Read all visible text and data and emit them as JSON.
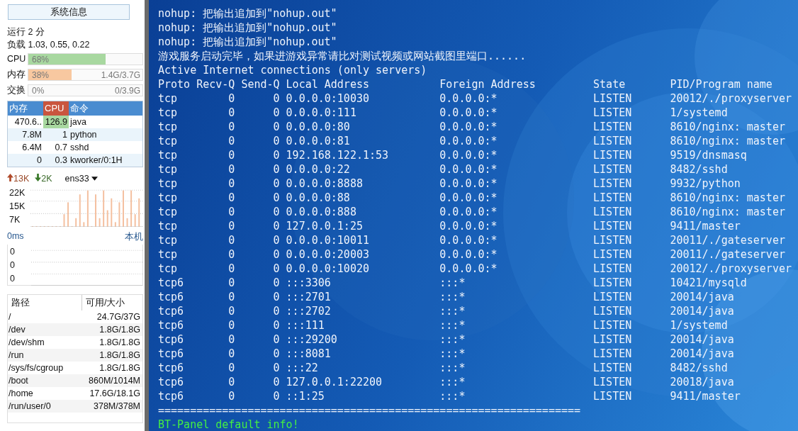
{
  "sidebar": {
    "title_button": "系统信息",
    "uptime": "运行 2 分",
    "load": "负载 1.03, 0.55, 0.22",
    "meters": [
      {
        "label": "CPU",
        "color": "#a8d8a0",
        "level": 0.68,
        "percent": "68%"
      },
      {
        "label": "内存",
        "color": "#f8c8a0",
        "level": 0.38,
        "percent": "38%",
        "amount": "1.4G/3.7G"
      },
      {
        "label": "交换",
        "percent": "0%",
        "amount": "0/3.9G"
      }
    ],
    "process_table": {
      "columns": [
        "内存",
        "CPU",
        "命令"
      ],
      "rows": [
        {
          "mem": "470.6..",
          "cpu": "126.9",
          "command": "java",
          "level": 1
        },
        {
          "mem": "7.8M",
          "cpu": "1",
          "command": "python"
        },
        {
          "mem": "6.4M",
          "cpu": "0.7",
          "command": "sshd"
        },
        {
          "mem": "0",
          "cpu": "0.3",
          "command": "kworker/0:1H"
        }
      ]
    },
    "network": {
      "upload": "13K",
      "download": "2K",
      "interface": "ens33",
      "ticks": [
        "22K",
        "15K",
        "7K"
      ]
    },
    "latency": {
      "value": "0ms",
      "target": "本机",
      "ticks": [
        "0",
        "0",
        "0"
      ]
    },
    "disk_table": {
      "columns": [
        "路径",
        "可用/大小"
      ],
      "rows": [
        {
          "path": "/",
          "usage": "24.7G/37G"
        },
        {
          "path": "/dev",
          "usage": "1.8G/1.8G"
        },
        {
          "path": "/dev/shm",
          "usage": "1.8G/1.8G"
        },
        {
          "path": "/run",
          "usage": "1.8G/1.8G"
        },
        {
          "path": "/sys/fs/cgroup",
          "usage": "1.8G/1.8G"
        },
        {
          "path": "/boot",
          "usage": "860M/1014M"
        },
        {
          "path": "/home",
          "usage": "17.6G/18.1G"
        },
        {
          "path": "/run/user/0",
          "usage": "378M/378M"
        }
      ]
    }
  },
  "terminal": {
    "lines": [
      "nohup: 把输出追加到\"nohup.out\"",
      "nohup: 把输出追加到\"nohup.out\"",
      "nohup: 把输出追加到\"nohup.out\"",
      "游戏服务启动完毕，如果进游戏异常请比对测试视频或网站截图里端口......",
      "Active Internet connections (only servers)"
    ],
    "columns": [
      "Proto",
      "Recv-Q",
      "Send-Q",
      "Local Address",
      "Foreign Address",
      "State",
      "PID/Program name"
    ],
    "connections": [
      [
        "tcp",
        "0",
        "0",
        "0.0.0.0:10030",
        "0.0.0.0:*",
        "LISTEN",
        "20012/./proxyserver"
      ],
      [
        "tcp",
        "0",
        "0",
        "0.0.0.0:111",
        "0.0.0.0:*",
        "LISTEN",
        "1/systemd"
      ],
      [
        "tcp",
        "0",
        "0",
        "0.0.0.0:80",
        "0.0.0.0:*",
        "LISTEN",
        "8610/nginx: master"
      ],
      [
        "tcp",
        "0",
        "0",
        "0.0.0.0:81",
        "0.0.0.0:*",
        "LISTEN",
        "8610/nginx: master"
      ],
      [
        "tcp",
        "0",
        "0",
        "192.168.122.1:53",
        "0.0.0.0:*",
        "LISTEN",
        "9519/dnsmasq"
      ],
      [
        "tcp",
        "0",
        "0",
        "0.0.0.0:22",
        "0.0.0.0:*",
        "LISTEN",
        "8482/sshd"
      ],
      [
        "tcp",
        "0",
        "0",
        "0.0.0.0:8888",
        "0.0.0.0:*",
        "LISTEN",
        "9932/python"
      ],
      [
        "tcp",
        "0",
        "0",
        "0.0.0.0:88",
        "0.0.0.0:*",
        "LISTEN",
        "8610/nginx: master"
      ],
      [
        "tcp",
        "0",
        "0",
        "0.0.0.0:888",
        "0.0.0.0:*",
        "LISTEN",
        "8610/nginx: master"
      ],
      [
        "tcp",
        "0",
        "0",
        "127.0.0.1:25",
        "0.0.0.0:*",
        "LISTEN",
        "9411/master"
      ],
      [
        "tcp",
        "0",
        "0",
        "0.0.0.0:10011",
        "0.0.0.0:*",
        "LISTEN",
        "20011/./gateserver"
      ],
      [
        "tcp",
        "0",
        "0",
        "0.0.0.0:20003",
        "0.0.0.0:*",
        "LISTEN",
        "20011/./gateserver"
      ],
      [
        "tcp",
        "0",
        "0",
        "0.0.0.0:10020",
        "0.0.0.0:*",
        "LISTEN",
        "20012/./proxyserver"
      ],
      [
        "tcp6",
        "0",
        "0",
        ":::3306",
        ":::*",
        "LISTEN",
        "10421/mysqld"
      ],
      [
        "tcp6",
        "0",
        "0",
        ":::2701",
        ":::*",
        "LISTEN",
        "20014/java"
      ],
      [
        "tcp6",
        "0",
        "0",
        ":::2702",
        ":::*",
        "LISTEN",
        "20014/java"
      ],
      [
        "tcp6",
        "0",
        "0",
        ":::111",
        ":::*",
        "LISTEN",
        "1/systemd"
      ],
      [
        "tcp6",
        "0",
        "0",
        ":::29200",
        ":::*",
        "LISTEN",
        "20014/java"
      ],
      [
        "tcp6",
        "0",
        "0",
        ":::8081",
        ":::*",
        "LISTEN",
        "20014/java"
      ],
      [
        "tcp6",
        "0",
        "0",
        ":::22",
        ":::*",
        "LISTEN",
        "8482/sshd"
      ],
      [
        "tcp6",
        "0",
        "0",
        "127.0.0.1:22200",
        ":::*",
        "LISTEN",
        "20018/java"
      ],
      [
        "tcp6",
        "0",
        "0",
        "::1:25",
        ":::*",
        "LISTEN",
        "9411/master"
      ]
    ],
    "separator": "==================================================================",
    "footer": "BT-Panel default info!"
  }
}
